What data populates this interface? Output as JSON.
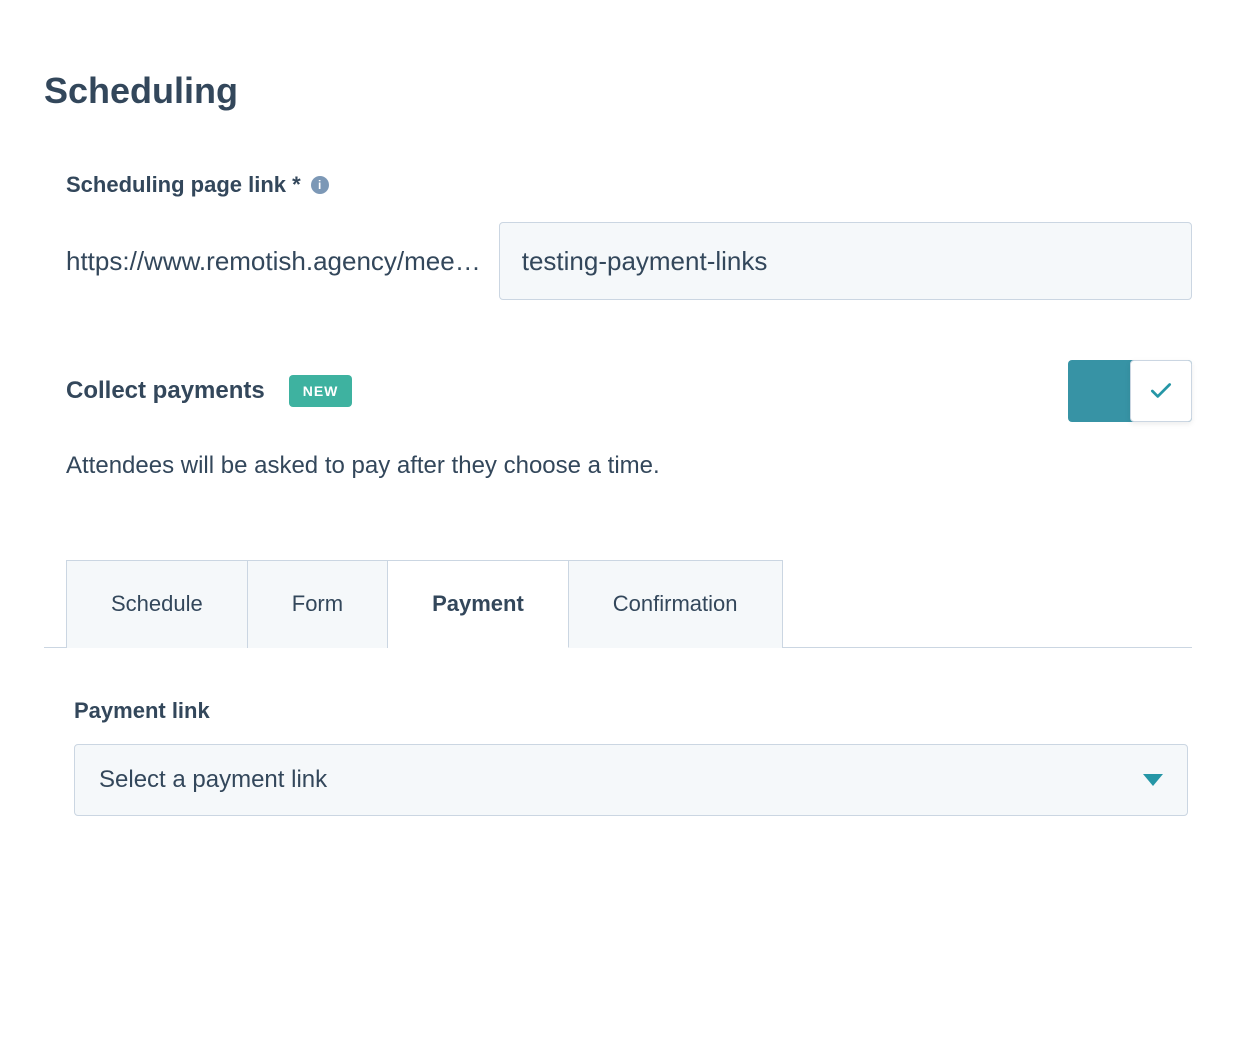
{
  "header": {
    "title": "Scheduling"
  },
  "scheduling_link": {
    "label": "Scheduling page link *",
    "url_prefix": "https://www.remotish.agency/mee…",
    "slug_value": "testing-payment-links"
  },
  "collect_payments": {
    "label": "Collect payments",
    "badge": "NEW",
    "enabled": true,
    "description": "Attendees will be asked to pay after they choose a time."
  },
  "tabs": [
    {
      "label": "Schedule",
      "active": false
    },
    {
      "label": "Form",
      "active": false
    },
    {
      "label": "Payment",
      "active": true
    },
    {
      "label": "Confirmation",
      "active": false
    }
  ],
  "payment_link": {
    "label": "Payment link",
    "placeholder": "Select a payment link"
  }
}
